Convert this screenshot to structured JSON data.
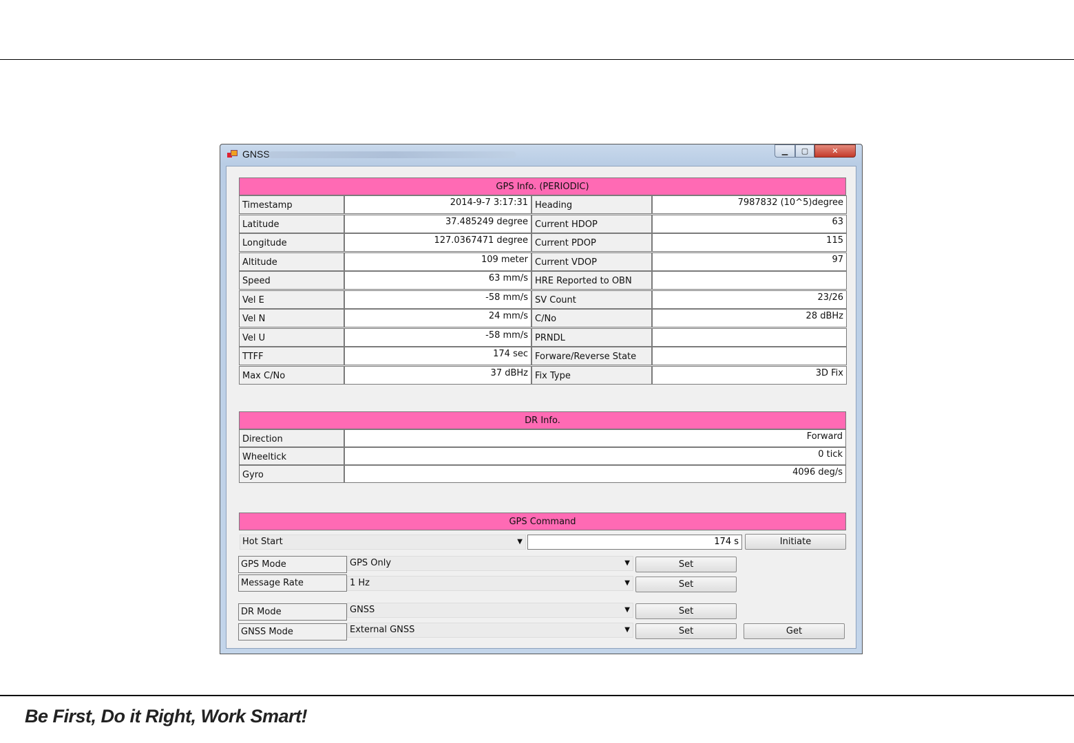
{
  "window": {
    "title": "GNSS",
    "minimize": "▁",
    "maximize": "▢",
    "close": "✕"
  },
  "gps_info": {
    "header": "GPS Info. (PERIODIC)",
    "rows": [
      {
        "label": "Timestamp",
        "value": "2014-9-7 3:17:31",
        "label2": "Heading",
        "value2": "7987832 (10^5)degree"
      },
      {
        "label": "Latitude",
        "value": "37.485249 degree",
        "label2": "Current HDOP",
        "value2": "63"
      },
      {
        "label": "Longitude",
        "value": "127.0367471 degree",
        "label2": "Current PDOP",
        "value2": "115"
      },
      {
        "label": "Altitude",
        "value": "109 meter",
        "label2": "Current VDOP",
        "value2": "97"
      },
      {
        "label": "Speed",
        "value": "63 mm/s",
        "label2": "HRE Reported to OBN",
        "value2": ""
      },
      {
        "label": "Vel E",
        "value": "-58 mm/s",
        "label2": "SV Count",
        "value2": "23/26"
      },
      {
        "label": "Vel N",
        "value": "24 mm/s",
        "label2": "C/No",
        "value2": "28 dBHz"
      },
      {
        "label": "Vel U",
        "value": "-58 mm/s",
        "label2": "PRNDL",
        "value2": ""
      },
      {
        "label": "TTFF",
        "value": "174 sec",
        "label2": "Forware/Reverse State",
        "value2": ""
      },
      {
        "label": "Max C/No",
        "value": "37 dBHz",
        "label2": "Fix Type",
        "value2": "3D Fix"
      }
    ]
  },
  "dr_info": {
    "header": "DR Info.",
    "rows": [
      {
        "label": "Direction",
        "value": "Forward"
      },
      {
        "label": "Wheeltick",
        "value": "0 tick"
      },
      {
        "label": "Gyro",
        "value": "4096 deg/s"
      }
    ]
  },
  "gps_command": {
    "header": "GPS Command",
    "start_combo": "Hot Start",
    "start_time": "174 s",
    "initiate_label": "Initiate",
    "gps_mode": {
      "label": "GPS Mode",
      "value": "GPS Only",
      "button": "Set"
    },
    "message_rate": {
      "label": "Message Rate",
      "value": "1 Hz",
      "button": "Set"
    },
    "dr_mode": {
      "label": "DR Mode",
      "value": "GNSS",
      "button": "Set"
    },
    "gnss_mode": {
      "label": "GNSS Mode",
      "value": "External GNSS",
      "button": "Set",
      "get_button": "Get"
    }
  },
  "slogan": "Be First, Do it Right, Work Smart!"
}
